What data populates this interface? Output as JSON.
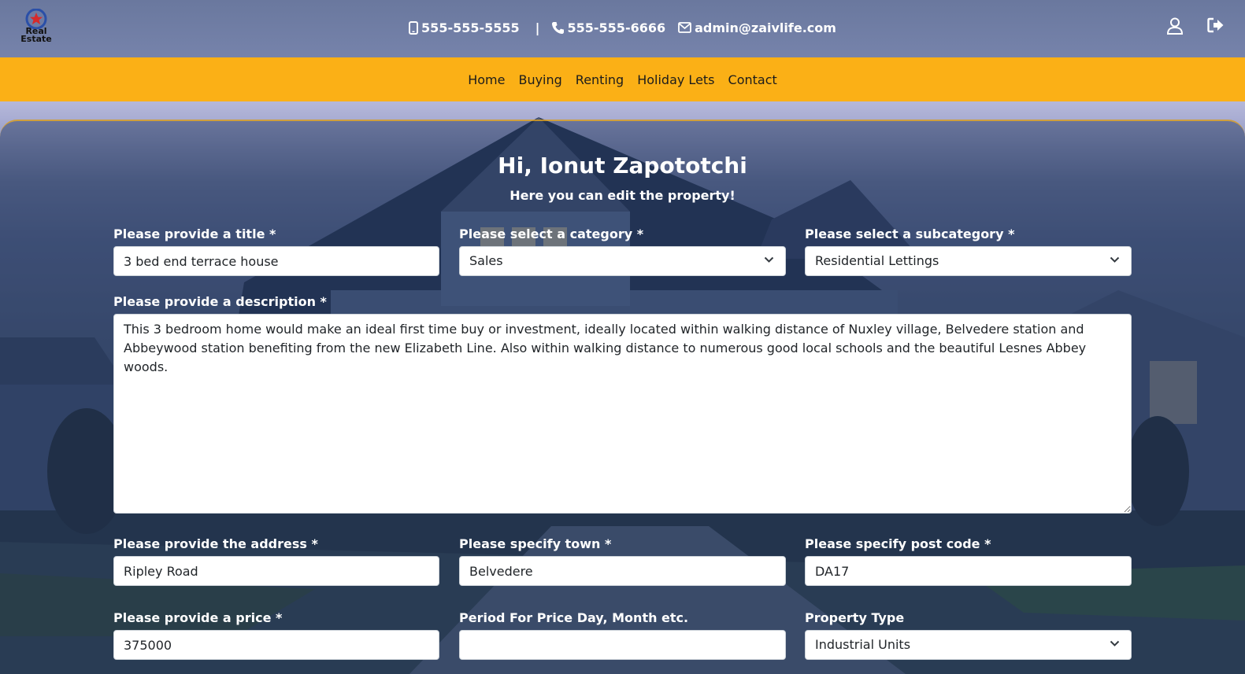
{
  "header": {
    "logo": {
      "text_line1": "Real",
      "text_line2": "Estate"
    },
    "mobile": "555-555-5555",
    "separator": "|",
    "phone": "555-555-6666",
    "email": "admin@zaivlife.com",
    "icons": [
      "mobile-icon",
      "phone-icon",
      "envelope-icon",
      "user-icon",
      "sign-out-icon"
    ]
  },
  "nav": {
    "items": [
      "Home",
      "Buying",
      "Renting",
      "Holiday Lets",
      "Contact"
    ],
    "background": "#fbb016"
  },
  "form": {
    "greeting": "Hi, Ionut Zapototchi",
    "subtitle": "Here you can edit the property!",
    "title": {
      "label": "Please provide a title *",
      "value": "3 bed end terrace house"
    },
    "category": {
      "label": "Please select a category *",
      "value": "Sales"
    },
    "subcategory": {
      "label": "Please select a subcategory *",
      "value": "Residential Lettings"
    },
    "description": {
      "label": "Please provide a description *",
      "value": "This 3 bedroom home would make an ideal first time buy or investment, ideally located within walking distance of Nuxley village, Belvedere station and Abbeywood station benefiting from the new Elizabeth Line. Also within walking distance to numerous good local schools and the beautiful Lesnes Abbey woods."
    },
    "address": {
      "label": "Please provide the address *",
      "value": "Ripley Road"
    },
    "town": {
      "label": "Please specify town *",
      "value": "Belvedere"
    },
    "postcode": {
      "label": "Please specify post code *",
      "value": "DA17"
    },
    "price": {
      "label": "Please provide a price *",
      "value": "375000"
    },
    "period": {
      "label": "Period For Price Day, Month etc.",
      "value": ""
    },
    "property_type": {
      "label": "Property Type",
      "value": "Industrial Units"
    }
  }
}
